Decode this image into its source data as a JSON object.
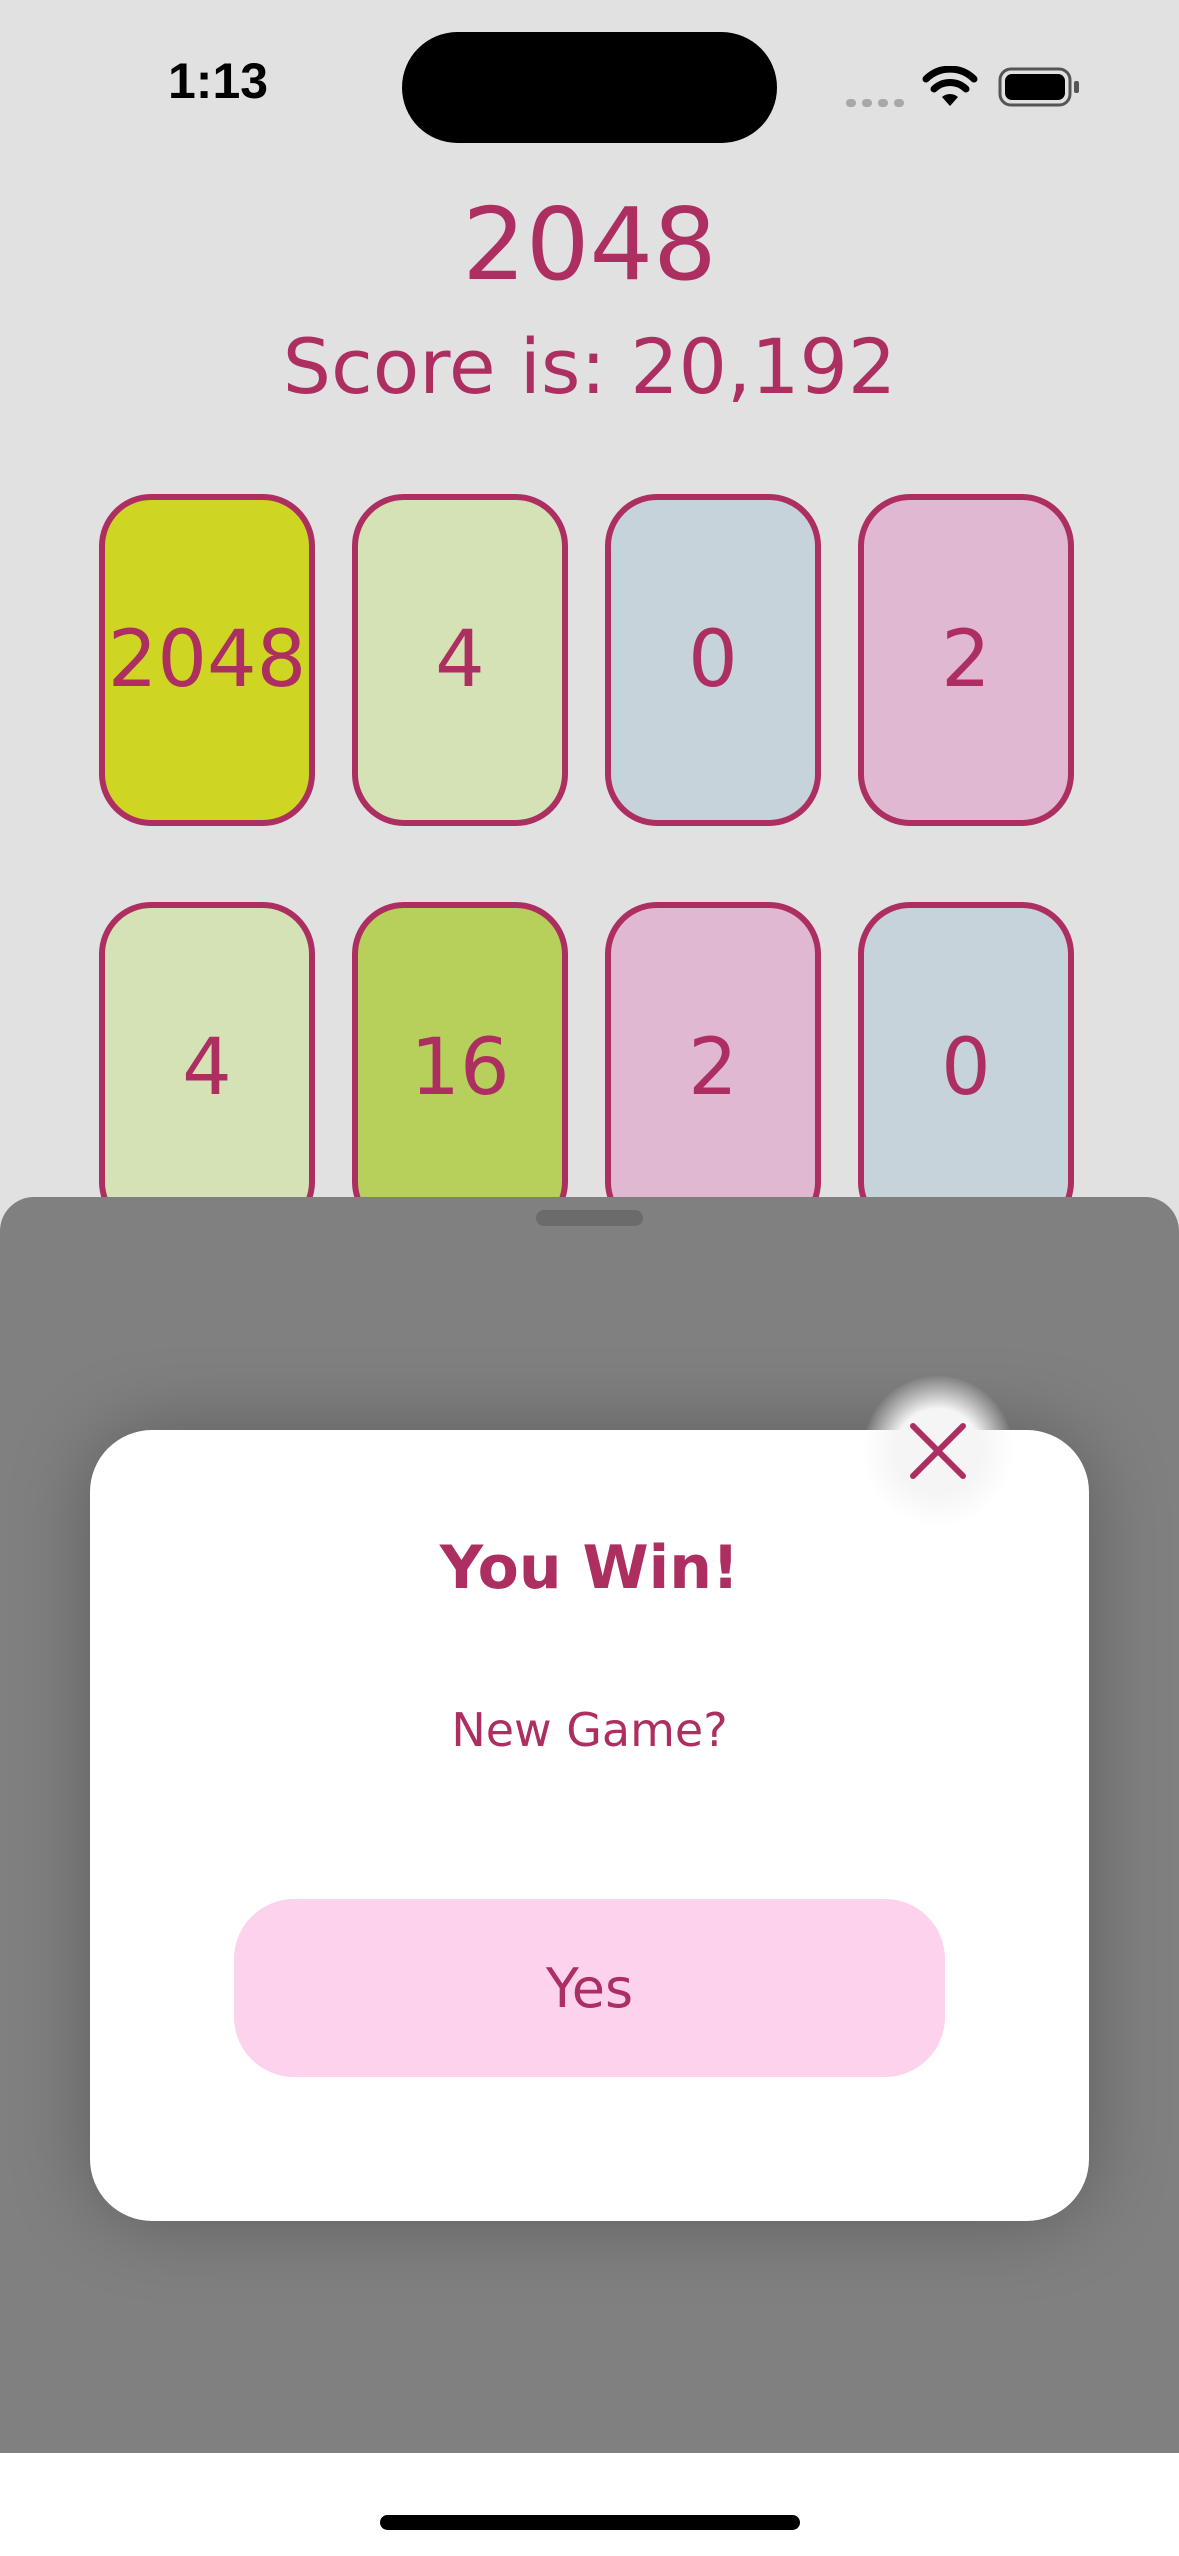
{
  "status_bar": {
    "time": "1:13",
    "icons": [
      "signal-icon",
      "wifi-icon",
      "battery-icon"
    ]
  },
  "header": {
    "title": "2048",
    "score_text": "Score is: 20,192"
  },
  "board": {
    "rows": [
      [
        "2048",
        "4",
        "0",
        "2"
      ],
      [
        "4",
        "16",
        "2",
        "0"
      ]
    ]
  },
  "dialog": {
    "title": "You Win!",
    "message": "New Game?",
    "yes_label": "Yes",
    "close_icon": "close-icon"
  },
  "colors": {
    "accent": "#ad2f62",
    "background": "#e1e1e1",
    "tile_2048": "#cfd523",
    "tile_4": "#d4e2b6",
    "tile_0": "#c7d3da",
    "tile_2": "#e1b8d2",
    "tile_16": "#b7cf5b",
    "sheet": "#808080",
    "button": "#fdd2ec"
  }
}
